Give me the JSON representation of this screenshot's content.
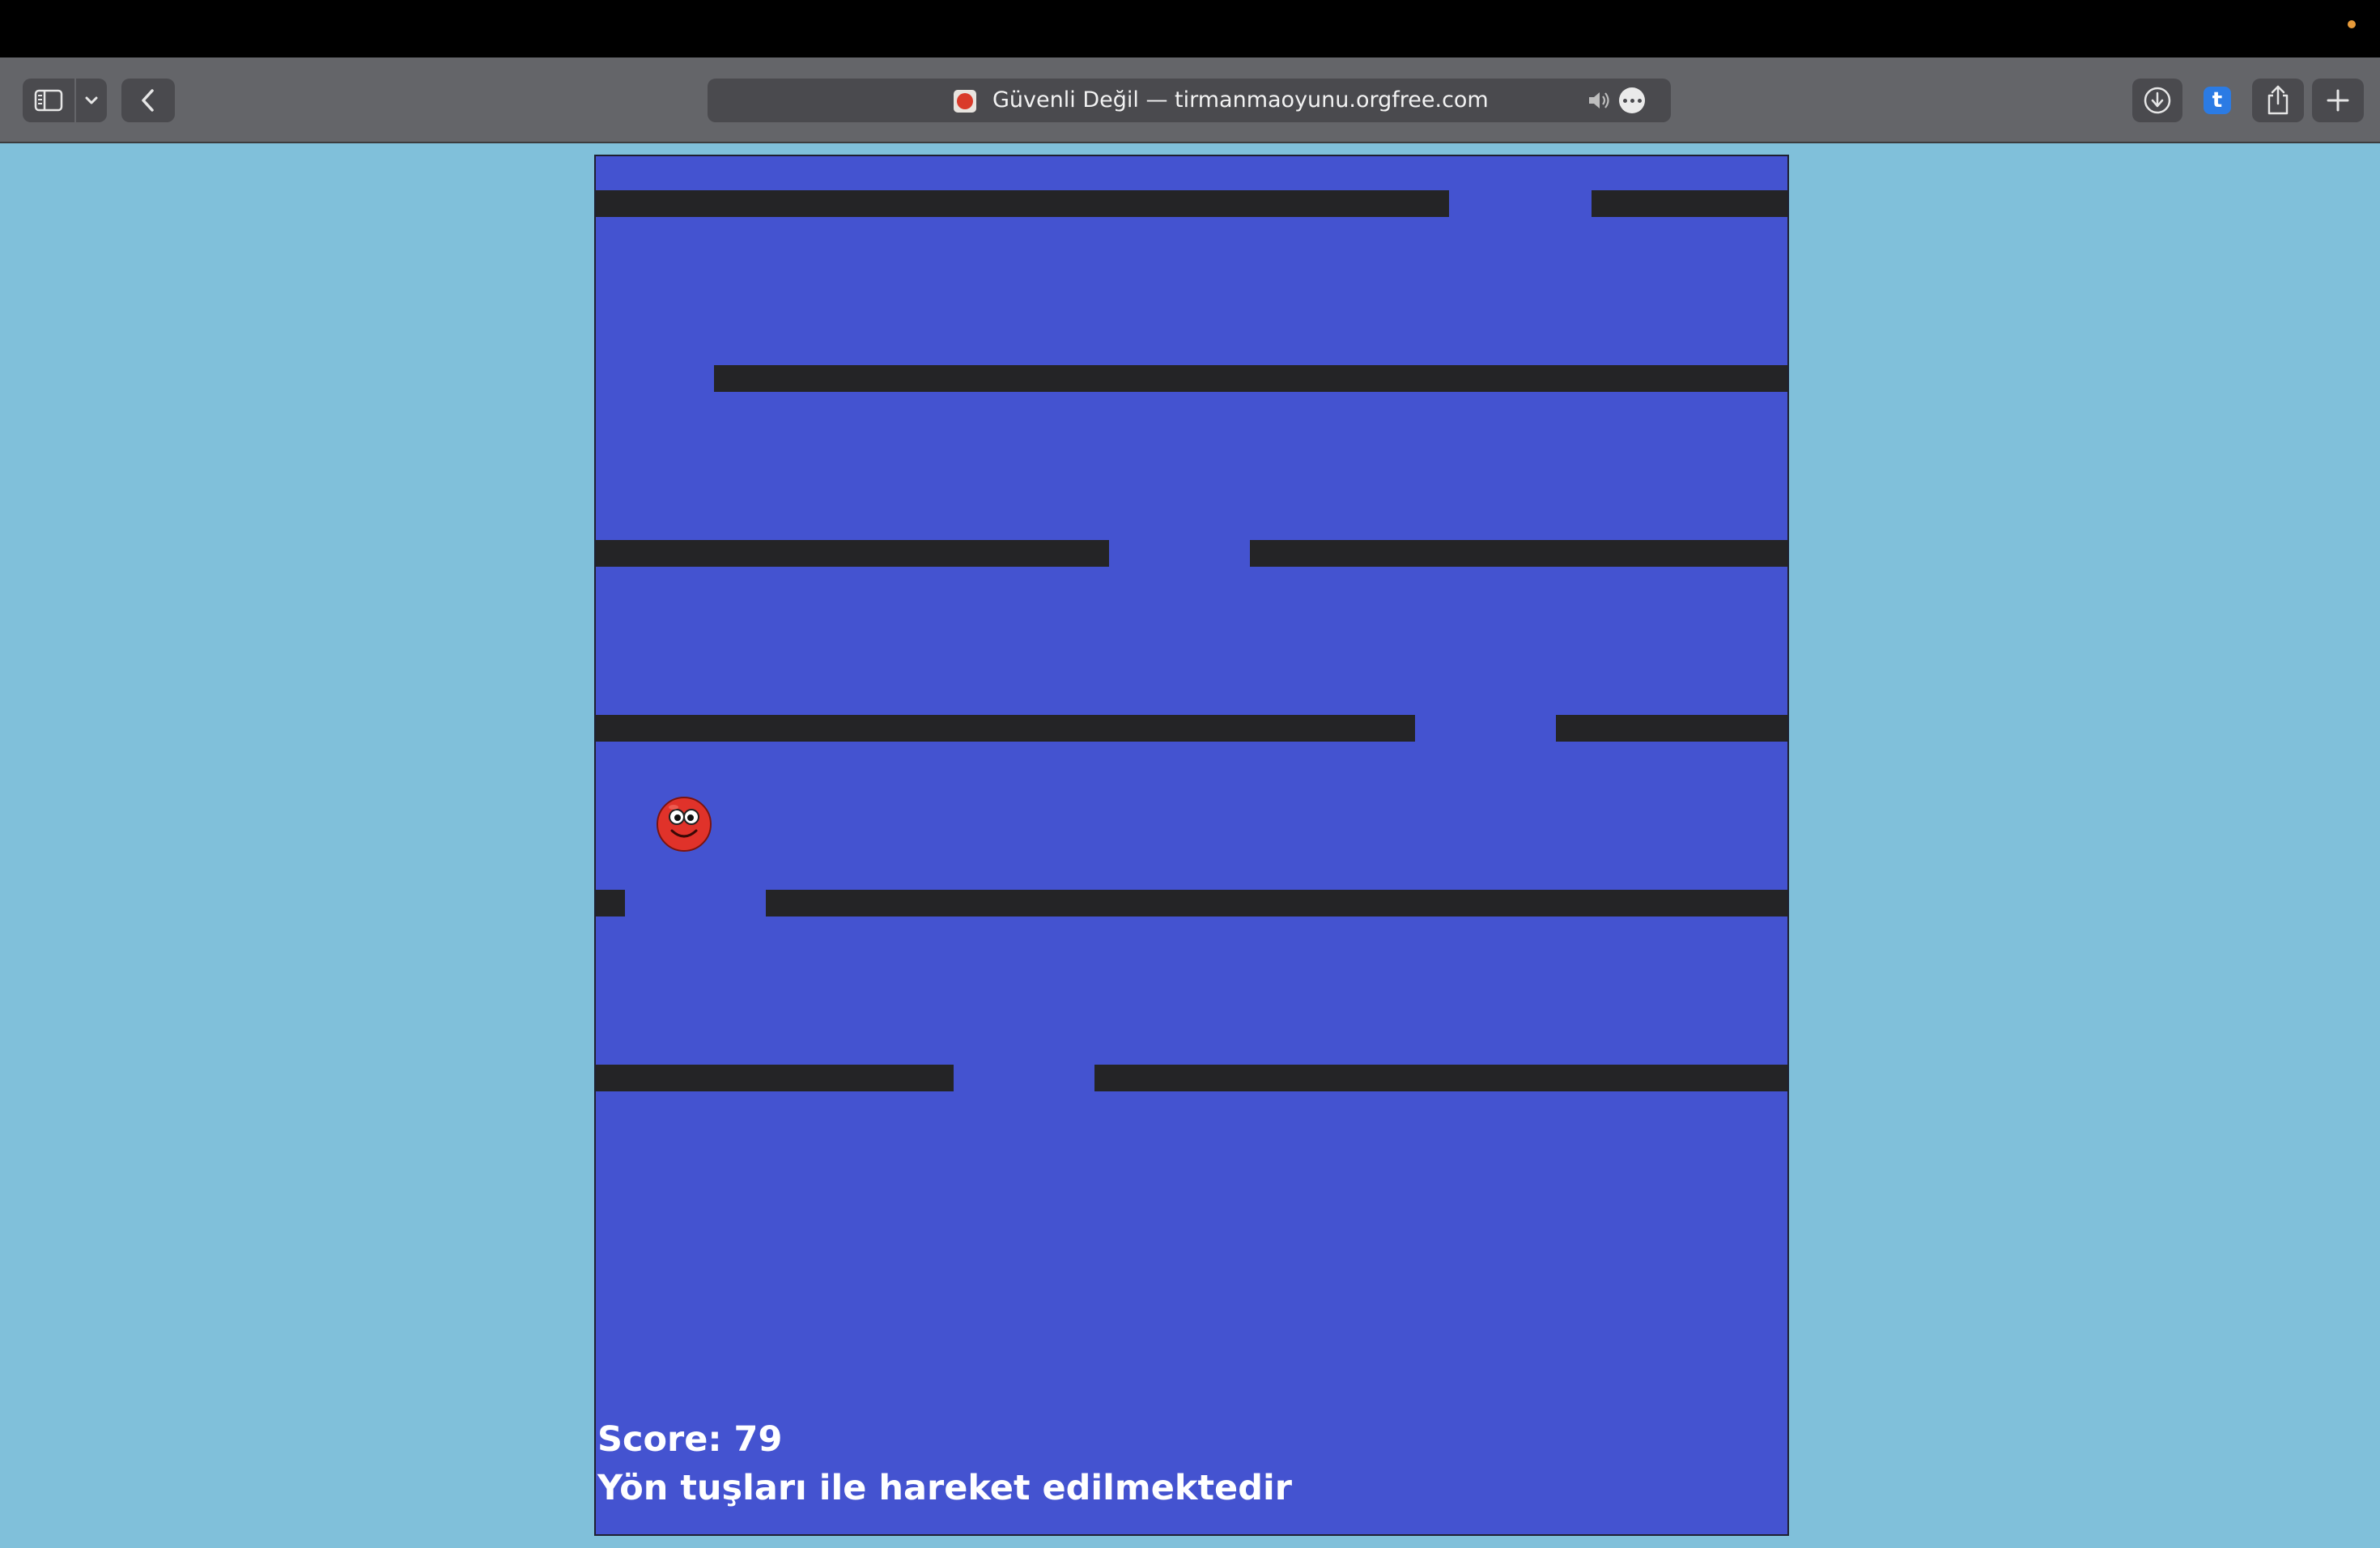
{
  "browser": {
    "address": "Güvenli Değil — tirmanmaoyunu.orgfree.com",
    "extension_badge": "t",
    "accent_color": "#2b7be4"
  },
  "game": {
    "score_label": "Score: 79",
    "instructions": "Yön tuşları ile hareket edilmektedir",
    "colors": {
      "page_background": "#80c0da",
      "canvas_background": "#4453d0",
      "platform": "#242426",
      "player": "#e0322a"
    },
    "player": {
      "name": "red-smiley-ball"
    },
    "platforms": [
      {
        "name": "row-1-left"
      },
      {
        "name": "row-1-right"
      },
      {
        "name": "row-2"
      },
      {
        "name": "row-3-left"
      },
      {
        "name": "row-3-right"
      },
      {
        "name": "row-4-left"
      },
      {
        "name": "row-4-right"
      },
      {
        "name": "row-5-left"
      },
      {
        "name": "row-5-right"
      },
      {
        "name": "row-6-left"
      },
      {
        "name": "row-6-right"
      }
    ]
  }
}
